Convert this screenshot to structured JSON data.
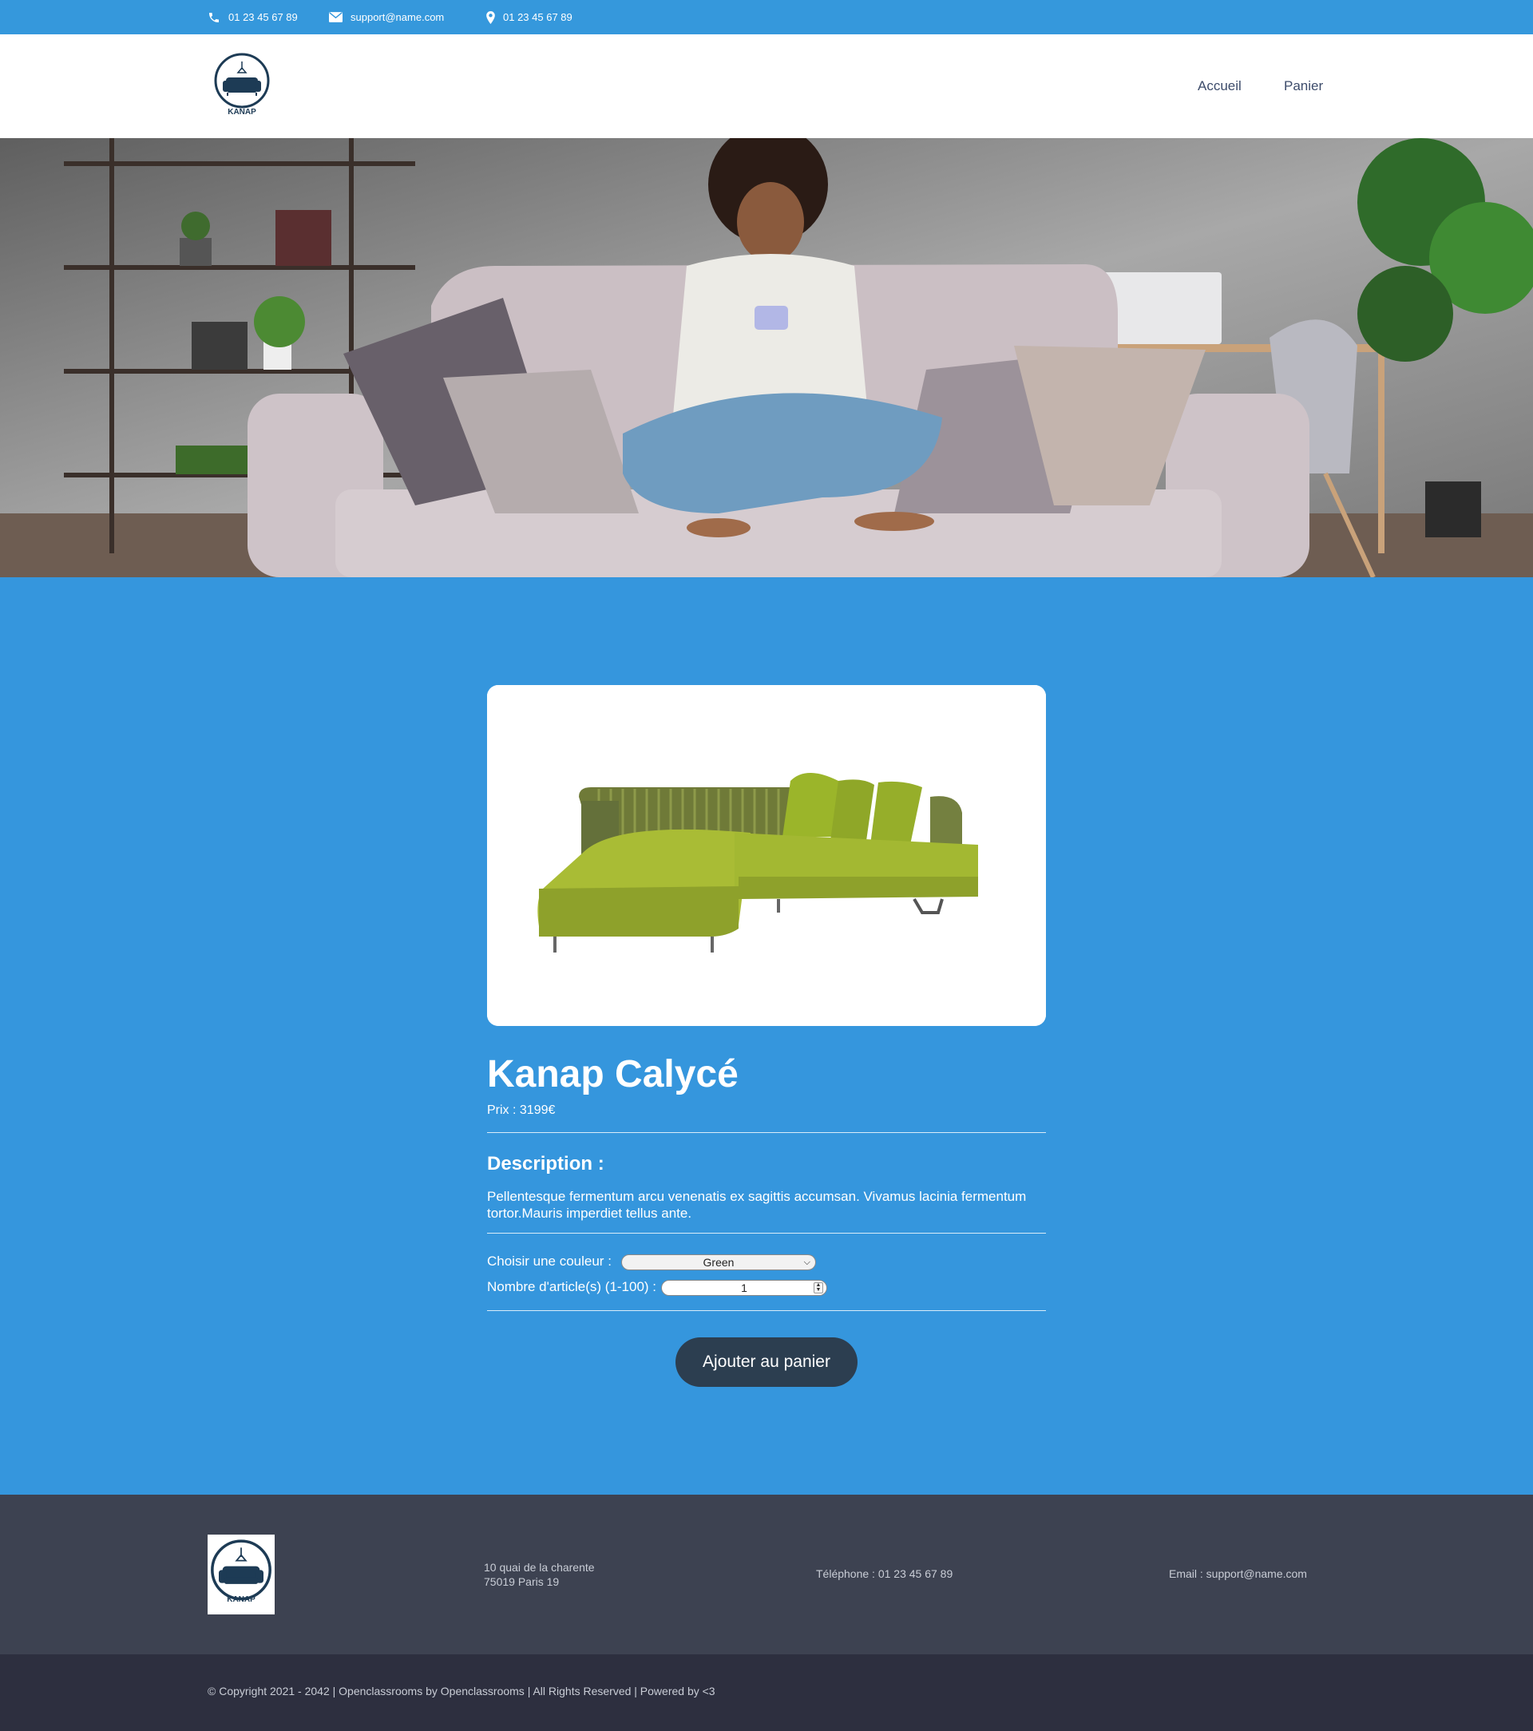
{
  "topbar": {
    "phone": "01 23 45 67 89",
    "email": "support@name.com",
    "address": "01 23 45 67 89"
  },
  "header": {
    "logo_text": "KANAP",
    "nav": [
      "Accueil",
      "Panier"
    ]
  },
  "product": {
    "title": "Kanap Calycé",
    "price": "Prix : 3199€",
    "description_title": "Description :",
    "description": "Pellentesque fermentum arcu venenatis ex sagittis accumsan. Vivamus lacinia fermentum tortor.Mauris imperdiet tellus ante.",
    "color_label": "Choisir une couleur :",
    "color_value": "Green",
    "quantity_label": "Nombre d'article(s) (1-100) :",
    "quantity_value": "1",
    "add_button": "Ajouter au panier"
  },
  "footer": {
    "logo_text": "KANAP",
    "address_line1": "10 quai de la charente",
    "address_line2": "75019 Paris 19",
    "phone": "Téléphone : 01 23 45 67 89",
    "email": "Email : support@name.com",
    "copyright": "© Copyright 2021 - 2042 | Openclassrooms by Openclassrooms | All Rights Reserved | Powered by <3"
  },
  "colors": {
    "primary_blue": "#3596dd",
    "header_bg": "#ffffff",
    "button_dark": "#2c3e50",
    "footer_bg": "#3d4251",
    "copyright_bg": "#2d2f3f",
    "logo_navy": "#1d3b55",
    "sofa_green": "#9bb52a"
  }
}
